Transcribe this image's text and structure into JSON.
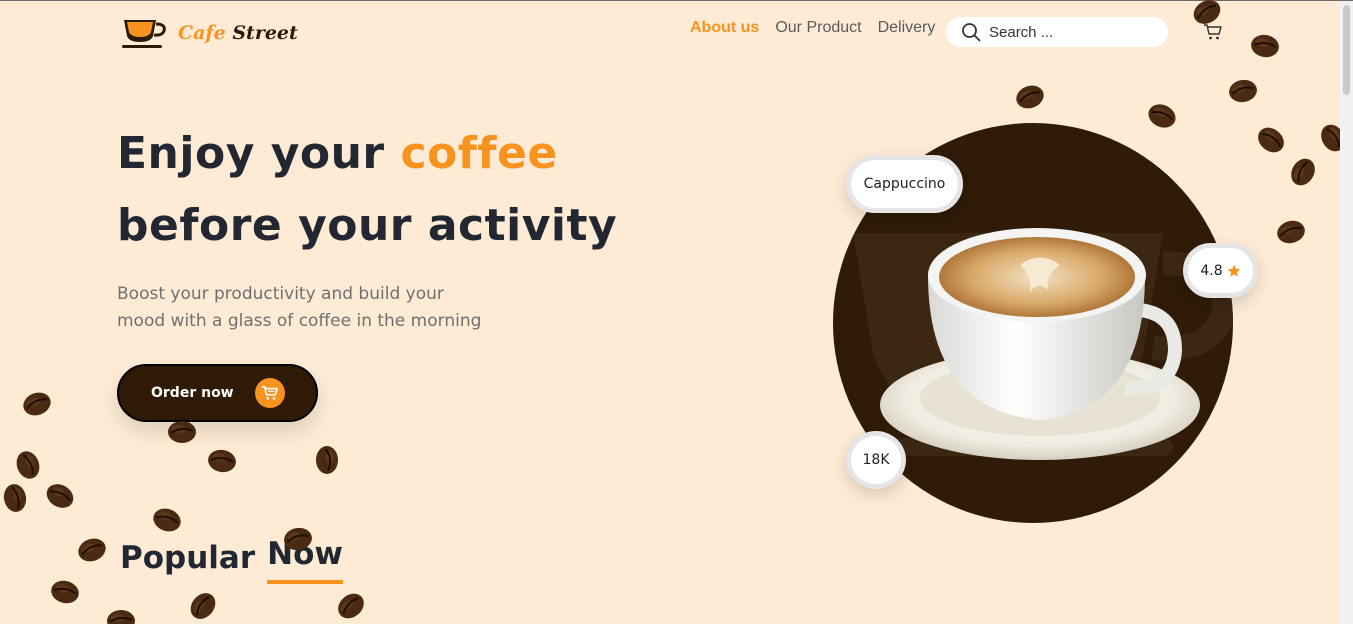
{
  "brand": {
    "name_part1": "Cafe",
    "name_part2": "Street"
  },
  "nav": {
    "items": [
      {
        "label": "About us",
        "active": true
      },
      {
        "label": "Our Product",
        "active": false
      },
      {
        "label": "Delivery",
        "active": false
      }
    ]
  },
  "search": {
    "placeholder": "Search ...",
    "icon": "search-icon"
  },
  "header": {
    "cart_icon": "cart-icon"
  },
  "hero": {
    "title_part1": "Enjoy your ",
    "title_accent": "coffee",
    "title_line2": "before your activity",
    "subtitle_line1": "Boost your productivity and build your",
    "subtitle_line2": "mood with a glass of coffee in the morning",
    "cta_label": "Order now"
  },
  "product_card": {
    "name": "Cappuccino",
    "rating": "4.8",
    "count": "18K"
  },
  "section": {
    "popular_part1": "Popular",
    "popular_part2": "Now"
  },
  "colors": {
    "background": "#fdebd5",
    "accent": "#f7931e",
    "dark_brown": "#2f1b05",
    "text_dark": "#222731",
    "text_muted": "#707070"
  }
}
